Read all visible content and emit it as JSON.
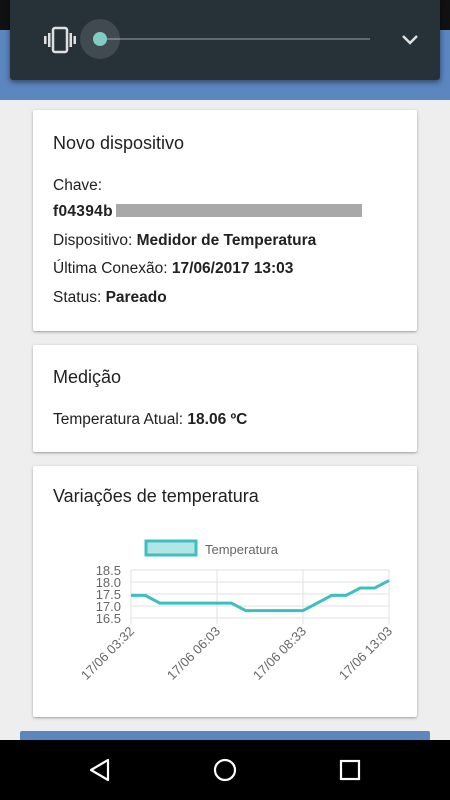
{
  "colors": {
    "accent_blue": "#5b86c0",
    "panel_bg": "#263238",
    "slider_thumb": "#80cbc4",
    "chart_line": "#3dbfbf",
    "chart_fill": "#b2e5e5"
  },
  "volume_panel": {
    "icon": "vibrate-icon",
    "level": 0,
    "expand_icon": "chevron-down-icon"
  },
  "device_card": {
    "title": "Novo dispositivo",
    "key_label": "Chave:",
    "key_value": "f04394b",
    "device_label": "Dispositivo:",
    "device_value": "Medidor de Temperatura",
    "last_conn_label": "Última Conexão:",
    "last_conn_value": "17/06/2017 13:03",
    "status_label": "Status:",
    "status_value": "Pareado"
  },
  "measure_card": {
    "title": "Medição",
    "temp_label": "Temperatura Atual:",
    "temp_value": "18.06 ºC"
  },
  "chart_card": {
    "title": "Variações de temperatura"
  },
  "chart_data": {
    "type": "line",
    "legend": [
      "Temperatura"
    ],
    "x_tick_labels": [
      "17/06 03:32",
      "17/06 06:03",
      "17/06 08:33",
      "17/06 13:03"
    ],
    "y_tick_labels": [
      "18.5",
      "18.0",
      "17.5",
      "17.0",
      "16.5"
    ],
    "ylim": [
      16.5,
      18.5
    ],
    "series": [
      {
        "name": "Temperatura",
        "values": [
          17.44,
          17.44,
          17.12,
          17.12,
          17.12,
          17.12,
          17.12,
          17.12,
          16.81,
          16.81,
          16.81,
          16.81,
          16.81,
          17.12,
          17.44,
          17.44,
          17.75,
          17.75,
          18.06
        ]
      }
    ],
    "grid": true,
    "legend_position": "top"
  },
  "nav": {
    "back_icon": "back-icon",
    "home_icon": "home-icon",
    "recents_icon": "recents-icon"
  }
}
